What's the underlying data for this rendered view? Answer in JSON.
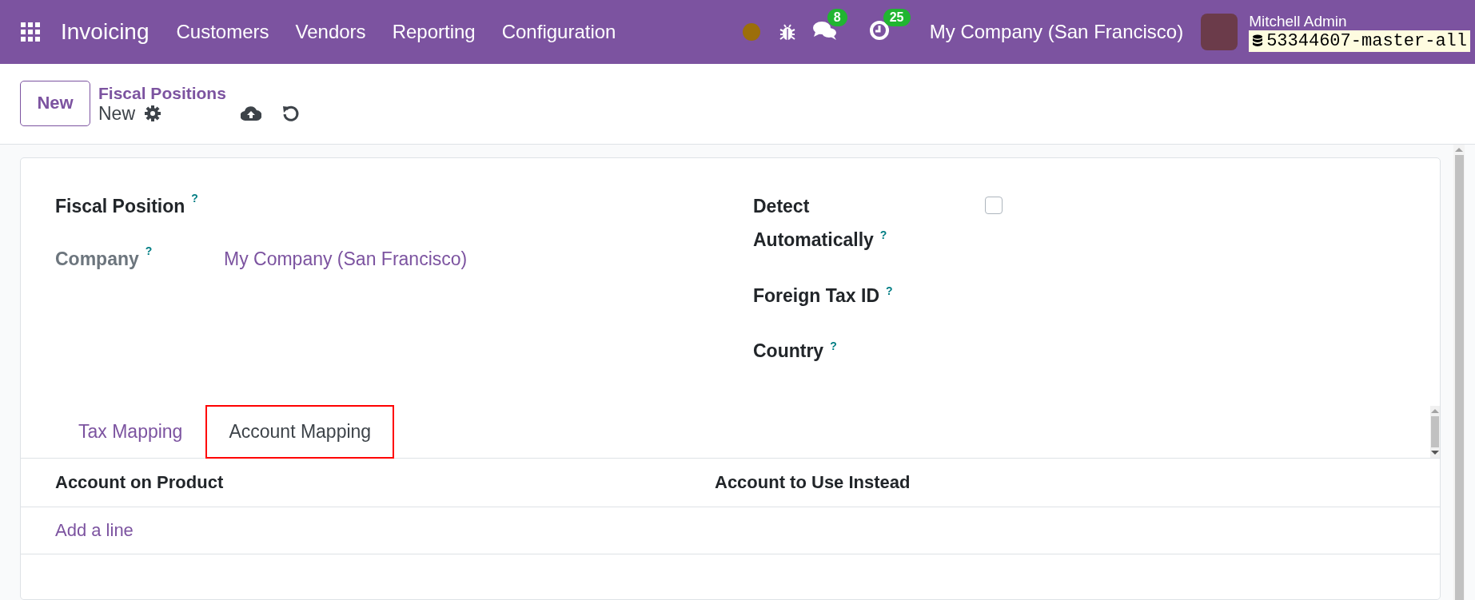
{
  "navbar": {
    "app_name": "Invoicing",
    "menu": [
      "Customers",
      "Vendors",
      "Reporting",
      "Configuration"
    ],
    "messages_badge": "8",
    "activities_badge": "25",
    "company": "My Company (San Francisco)",
    "user_name": "Mitchell Admin",
    "database": "53344607-master-all"
  },
  "control_panel": {
    "new_button": "New",
    "breadcrumb": "Fiscal Positions",
    "record_name": "New"
  },
  "form": {
    "left_fields": [
      {
        "kind": "title",
        "label": "Fiscal Position",
        "help": "?"
      },
      {
        "kind": "value",
        "label": "Company",
        "help": "?",
        "value": "My Company (San Francisco)"
      }
    ],
    "right_fields": [
      {
        "kind": "checkbox",
        "label": "Detect Automatically",
        "help": "?",
        "checked": false
      },
      {
        "kind": "text",
        "label": "Foreign Tax ID",
        "help": "?"
      },
      {
        "kind": "text",
        "label": "Country",
        "help": "?"
      }
    ],
    "tabs": [
      {
        "label": "Tax Mapping",
        "selected": false
      },
      {
        "label": "Account Mapping",
        "selected": true
      }
    ],
    "table": {
      "columns": [
        "Account on Product",
        "Account to Use Instead"
      ],
      "add_line": "Add a line"
    }
  }
}
